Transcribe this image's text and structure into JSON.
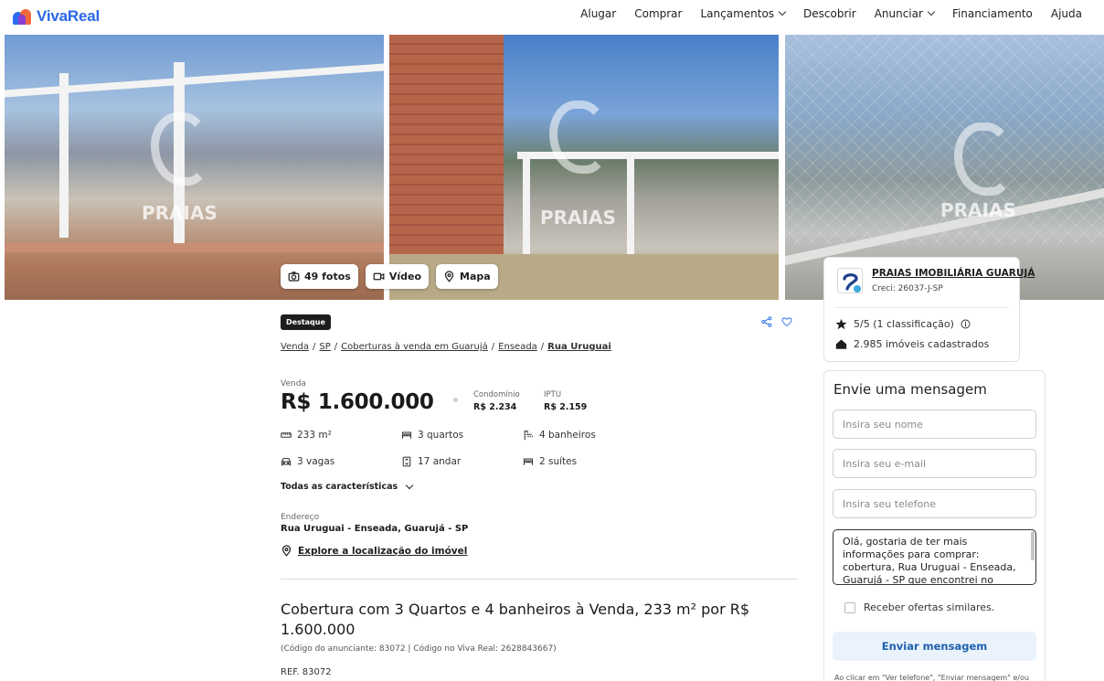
{
  "header": {
    "brand": "VivaReal",
    "nav": [
      {
        "label": "Alugar",
        "dropdown": false
      },
      {
        "label": "Comprar",
        "dropdown": false
      },
      {
        "label": "Lançamentos",
        "dropdown": true
      },
      {
        "label": "Descobrir",
        "dropdown": false
      },
      {
        "label": "Anunciar",
        "dropdown": true
      },
      {
        "label": "Financiamento",
        "dropdown": false
      },
      {
        "label": "Ajuda",
        "dropdown": false
      }
    ]
  },
  "gallery": {
    "watermark": "PRAIAS",
    "buttons": {
      "photos": "49 fotos",
      "video": "Vídeo",
      "map": "Mapa"
    }
  },
  "agency": {
    "name": "PRAIAS IMOBILIÁRIA GUARUJÁ",
    "creci": "Creci: 26037-J-SP",
    "rating": "5/5 (1 classificação)",
    "listings": "2.985 imóveis cadastrados"
  },
  "form": {
    "title": "Envie uma mensagem",
    "name_placeholder": "Insira seu nome",
    "email_placeholder": "Insira seu e-mail",
    "phone_placeholder": "Insira seu telefone",
    "message": "Olá, gostaria de ter mais informações para comprar: cobertura, Rua Uruguai - Enseada, Guarujá - SP que encontrei no",
    "similar_offers": "Receber ofertas similares.",
    "send": "Enviar mensagem",
    "note": "Ao clicar em \"Ver telefone\", \"Enviar mensagem\" e/ou"
  },
  "listing": {
    "badge": "Destaque",
    "breadcrumb": [
      "Venda",
      "SP",
      "Coberturas à venda em Guarujá",
      "Enseada",
      "Rua Uruguai"
    ],
    "price_label": "Venda",
    "price": "R$ 1.600.000",
    "condo_label": "Condomínio",
    "condo": "R$ 2.234",
    "iptu_label": "IPTU",
    "iptu": "R$ 2.159",
    "features": {
      "area": "233 m²",
      "bedrooms": "3 quartos",
      "bathrooms": "4 banheiros",
      "parking": "3 vagas",
      "floor": "17 andar",
      "suites": "2 suítes"
    },
    "all_features": "Todas as características",
    "address_label": "Endereço",
    "address": "Rua Uruguai - Enseada, Guarujá - SP",
    "explore": "Explore a localização do imóvel",
    "title": "Cobertura com 3 Quartos e 4 banheiros à Venda, 233 m² por R$ 1.600.000",
    "codes": "(Código do anunciante: 83072 | Código no Viva Real: 2628843667)",
    "ref": "REF. 83072"
  },
  "colors": {
    "brand": "#2b67e8",
    "send_bg": "#eaf3fc",
    "send_text": "#1e5fae",
    "share_icon": "#3b7be8"
  }
}
